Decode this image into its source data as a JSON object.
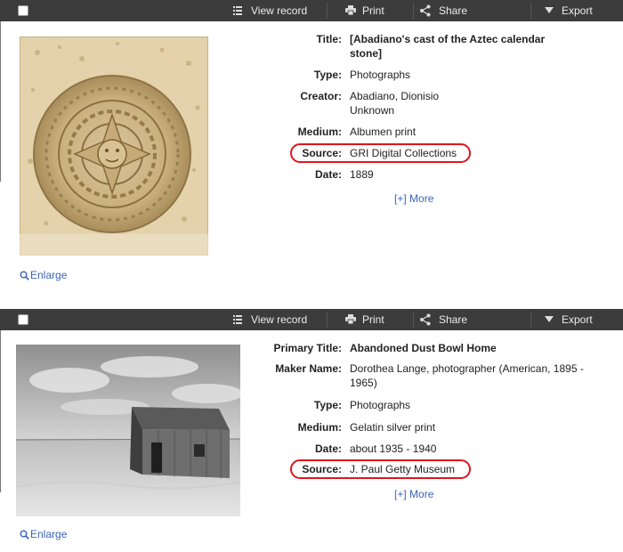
{
  "toolbar": {
    "view_record": "View record",
    "print": "Print",
    "share": "Share",
    "export": "Export"
  },
  "enlarge_label": "Enlarge",
  "more_label": "More",
  "more_bracket": "[+]",
  "records": [
    {
      "fields": {
        "title_label": "Title:",
        "title_line1": "[Abadiano's cast of the Aztec calendar",
        "title_line2": "stone]",
        "type_label": "Type:",
        "type_value": "Photographs",
        "creator_label": "Creator:",
        "creator_line1": "Abadiano, Dionisio",
        "creator_line2": "Unknown",
        "medium_label": "Medium:",
        "medium_value": "Albumen print",
        "source_label": "Source:",
        "source_value": "GRI Digital Collections",
        "date_label": "Date:",
        "date_value": "1889"
      }
    },
    {
      "fields": {
        "title_label": "Primary Title:",
        "title_value": "Abandoned Dust Bowl Home",
        "maker_label": "Maker Name:",
        "maker_line1": "Dorothea Lange, photographer (American, 1895 -",
        "maker_line2": "1965)",
        "type_label": "Type:",
        "type_value": "Photographs",
        "medium_label": "Medium:",
        "medium_value": "Gelatin silver print",
        "date_label": "Date:",
        "date_value": "about 1935 - 1940",
        "source_label": "Source:",
        "source_value": "J. Paul Getty Museum"
      }
    }
  ],
  "colors": {
    "toolbar_bg": "#3c3c3c",
    "link": "#3b63b8",
    "highlight_ring": "#e0151d"
  },
  "icons": [
    "checkbox",
    "list-icon",
    "print-icon",
    "share-icon",
    "export-arrow-icon",
    "magnifier-icon"
  ]
}
